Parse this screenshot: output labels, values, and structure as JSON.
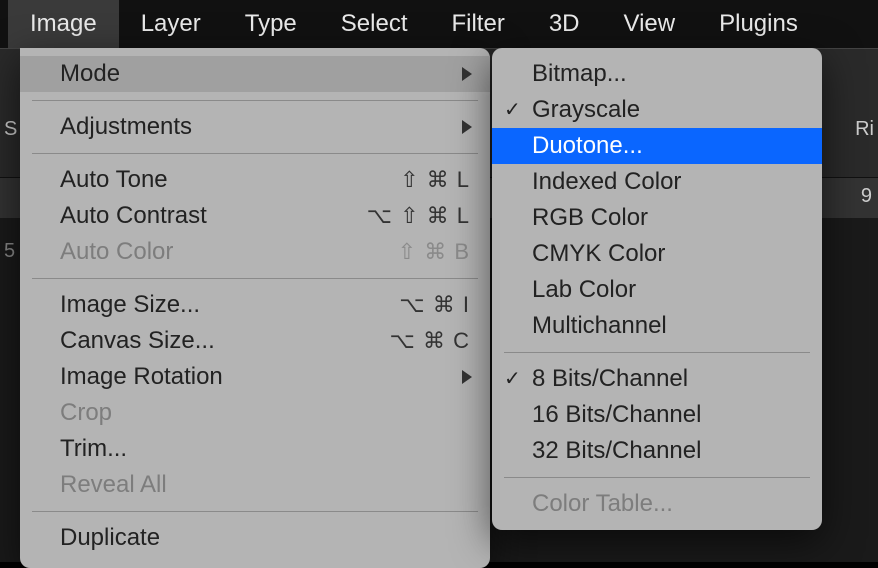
{
  "menubar": {
    "items": [
      {
        "label": "Image",
        "active": true
      },
      {
        "label": "Layer"
      },
      {
        "label": "Type"
      },
      {
        "label": "Select"
      },
      {
        "label": "Filter"
      },
      {
        "label": "3D"
      },
      {
        "label": "View"
      },
      {
        "label": "Plugins"
      }
    ]
  },
  "image_menu": {
    "groups": [
      [
        {
          "label": "Mode",
          "submenu": true,
          "hover": true
        }
      ],
      [
        {
          "label": "Adjustments",
          "submenu": true
        }
      ],
      [
        {
          "label": "Auto Tone",
          "shortcut": "⇧ ⌘ L"
        },
        {
          "label": "Auto Contrast",
          "shortcut": "⌥ ⇧ ⌘ L"
        },
        {
          "label": "Auto Color",
          "shortcut": "⇧ ⌘ B",
          "disabled": true
        }
      ],
      [
        {
          "label": "Image Size...",
          "shortcut": "⌥ ⌘ I"
        },
        {
          "label": "Canvas Size...",
          "shortcut": "⌥ ⌘ C"
        },
        {
          "label": "Image Rotation",
          "submenu": true
        },
        {
          "label": "Crop",
          "disabled": true
        },
        {
          "label": "Trim..."
        },
        {
          "label": "Reveal All",
          "disabled": true
        }
      ],
      [
        {
          "label": "Duplicate"
        }
      ]
    ]
  },
  "mode_menu": {
    "groups": [
      [
        {
          "label": "Bitmap..."
        },
        {
          "label": "Grayscale",
          "checked": true
        },
        {
          "label": "Duotone...",
          "selected": true
        },
        {
          "label": "Indexed Color"
        },
        {
          "label": "RGB Color"
        },
        {
          "label": "CMYK Color"
        },
        {
          "label": "Lab Color"
        },
        {
          "label": "Multichannel"
        }
      ],
      [
        {
          "label": "8 Bits/Channel",
          "checked": true
        },
        {
          "label": "16 Bits/Channel"
        },
        {
          "label": "32 Bits/Channel"
        }
      ],
      [
        {
          "label": "Color Table...",
          "disabled": true
        }
      ]
    ]
  },
  "backdrop": {
    "left_fragment": "S",
    "right_top": "Ri",
    "right_mid": "9",
    "bottom_left": "5"
  }
}
